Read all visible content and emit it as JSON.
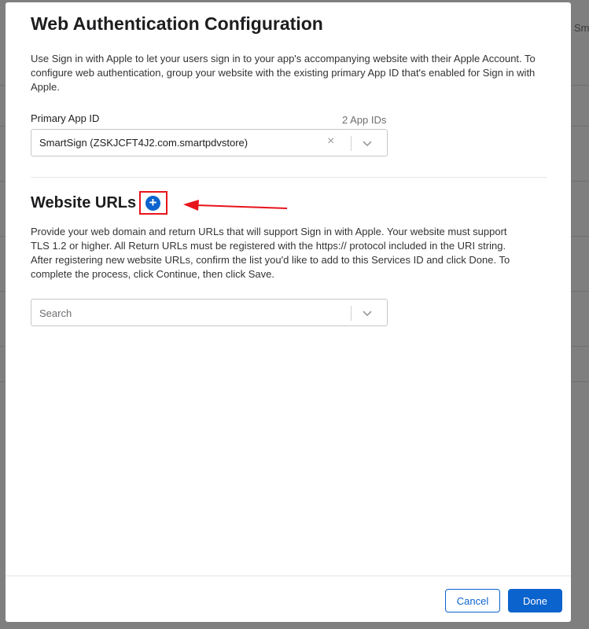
{
  "background": {
    "partial_text": "Sma"
  },
  "modal": {
    "title": "Web Authentication Configuration",
    "intro": "Use Sign in with Apple to let your users sign in to your app's accompanying website with their Apple Account. To configure web authentication, group your website with the existing primary App ID that's enabled for Sign in with Apple.",
    "primary_app": {
      "label": "Primary App ID",
      "count": "2 App IDs",
      "value": "SmartSign (ZSKJCFT4J2.com.smartpdvstore)",
      "clear_glyph": "×"
    },
    "website": {
      "title": "Website URLs",
      "add_glyph": "+",
      "description": "Provide your web domain and return URLs that will support Sign in with Apple. Your website must support TLS 1.2 or higher. All Return URLs must be registered with the https:// protocol included in the URI string. After registering new website URLs, confirm the list you'd like to add to this Services ID and click Done. To complete the process, click Continue, then click Save.",
      "search_placeholder": "Search"
    },
    "footer": {
      "cancel_label": "Cancel",
      "done_label": "Done"
    }
  },
  "colors": {
    "accent": "#0b63ce",
    "highlight": "#e8141c"
  }
}
